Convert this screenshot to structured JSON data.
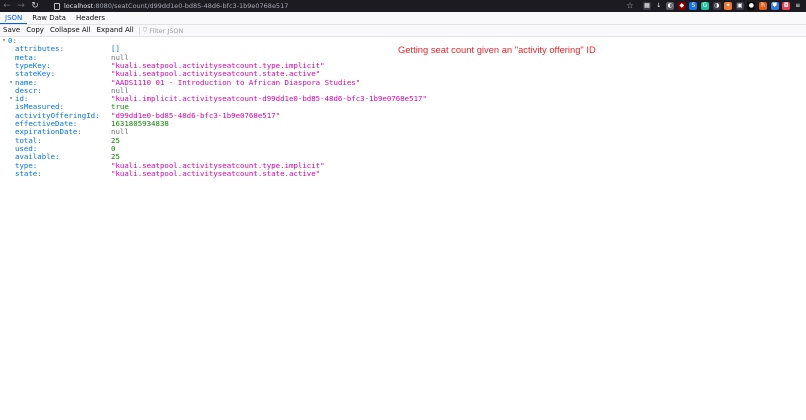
{
  "browser": {
    "url_host": "localhost",
    "url_path": ":8080/seatCount/d99dd1e0-bd85-48d6-bfc3-1b9e0768e517",
    "extensions": [
      {
        "name": "extensions-grid-icon",
        "color": "#3a3944",
        "glyph": "▦"
      },
      {
        "name": "download-icon",
        "color": "#1c1b22",
        "glyph": "↓"
      },
      {
        "name": "dark-reader-icon",
        "color": "#5a5a64",
        "glyph": "◐"
      },
      {
        "name": "ublock-icon",
        "color": "#800000",
        "glyph": "◆"
      },
      {
        "name": "translate-icon",
        "color": "#1a73e8",
        "glyph": "S"
      },
      {
        "name": "grammar-icon",
        "color": "#15c39a",
        "glyph": "G"
      },
      {
        "name": "theme-icon",
        "color": "#3a3944",
        "glyph": "◑"
      },
      {
        "name": "gift-icon",
        "color": "#f27830",
        "glyph": "✦"
      },
      {
        "name": "clipboard-icon",
        "color": "#3a3944",
        "glyph": "▣"
      },
      {
        "name": "tampermonkey-icon",
        "color": "#0a0a0a",
        "glyph": "●"
      },
      {
        "name": "honey-icon",
        "color": "#e05e1a",
        "glyph": "h"
      },
      {
        "name": "shield-icon",
        "color": "#2f7de1",
        "glyph": "⛊"
      },
      {
        "name": "pocket-icon",
        "color": "#ef4056",
        "glyph": "◘"
      },
      {
        "name": "menu-icon",
        "color": "#1c1b22",
        "glyph": "≡"
      }
    ]
  },
  "viewer": {
    "tabs": [
      "JSON",
      "Raw Data",
      "Headers"
    ],
    "active_tab": "JSON",
    "actions": [
      "Save",
      "Copy",
      "Collapse All",
      "Expand All"
    ],
    "filter_placeholder": "Filter JSON"
  },
  "json_tree": [
    {
      "key": "0:",
      "value": "",
      "type": "root",
      "indent": 0,
      "twisty": true
    },
    {
      "key": "attributes:",
      "value": "[]",
      "type": "array",
      "indent": 1,
      "twisty": false
    },
    {
      "key": "meta:",
      "value": "null",
      "type": "null",
      "indent": 1,
      "twisty": false
    },
    {
      "key": "typeKey:",
      "value": "\"kuali.seatpool.activityseatcount.type.implicit\"",
      "type": "string",
      "indent": 1,
      "twisty": false
    },
    {
      "key": "stateKey:",
      "value": "\"kuali.seatpool.activityseatcount.state.active\"",
      "type": "string",
      "indent": 1,
      "twisty": false
    },
    {
      "key": "name:",
      "value": "\"AADS1110 01 - Introduction to African Diaspora Studies\"",
      "type": "string",
      "indent": 1,
      "twisty": true
    },
    {
      "key": "descr:",
      "value": "null",
      "type": "null",
      "indent": 1,
      "twisty": false
    },
    {
      "key": "id:",
      "value": "\"kuali.implicit.activityseatcount-d99dd1e0-bd85-48d6-bfc3-1b9e0768e517\"",
      "type": "string",
      "indent": 1,
      "twisty": true
    },
    {
      "key": "isMeasured:",
      "value": "true",
      "type": "bool",
      "indent": 1,
      "twisty": false
    },
    {
      "key": "activityOfferingId:",
      "value": "\"d99dd1e0-bd85-48d6-bfc3-1b9e0768e517\"",
      "type": "string",
      "indent": 1,
      "twisty": false
    },
    {
      "key": "effectiveDate:",
      "value": "1631805934838",
      "type": "number",
      "indent": 1,
      "twisty": false
    },
    {
      "key": "expirationDate:",
      "value": "null",
      "type": "null",
      "indent": 1,
      "twisty": false
    },
    {
      "key": "total:",
      "value": "25",
      "type": "number",
      "indent": 1,
      "twisty": false
    },
    {
      "key": "used:",
      "value": "0",
      "type": "number",
      "indent": 1,
      "twisty": false
    },
    {
      "key": "available:",
      "value": "25",
      "type": "number",
      "indent": 1,
      "twisty": false
    },
    {
      "key": "type:",
      "value": "\"kuali.seatpool.activityseatcount.type.implicit\"",
      "type": "string",
      "indent": 1,
      "twisty": false
    },
    {
      "key": "state:",
      "value": "\"kuali.seatpool.activityseatcount.state.active\"",
      "type": "string",
      "indent": 1,
      "twisty": false
    }
  ],
  "annotation": "Getting seat count given an \"activity offering\" ID"
}
